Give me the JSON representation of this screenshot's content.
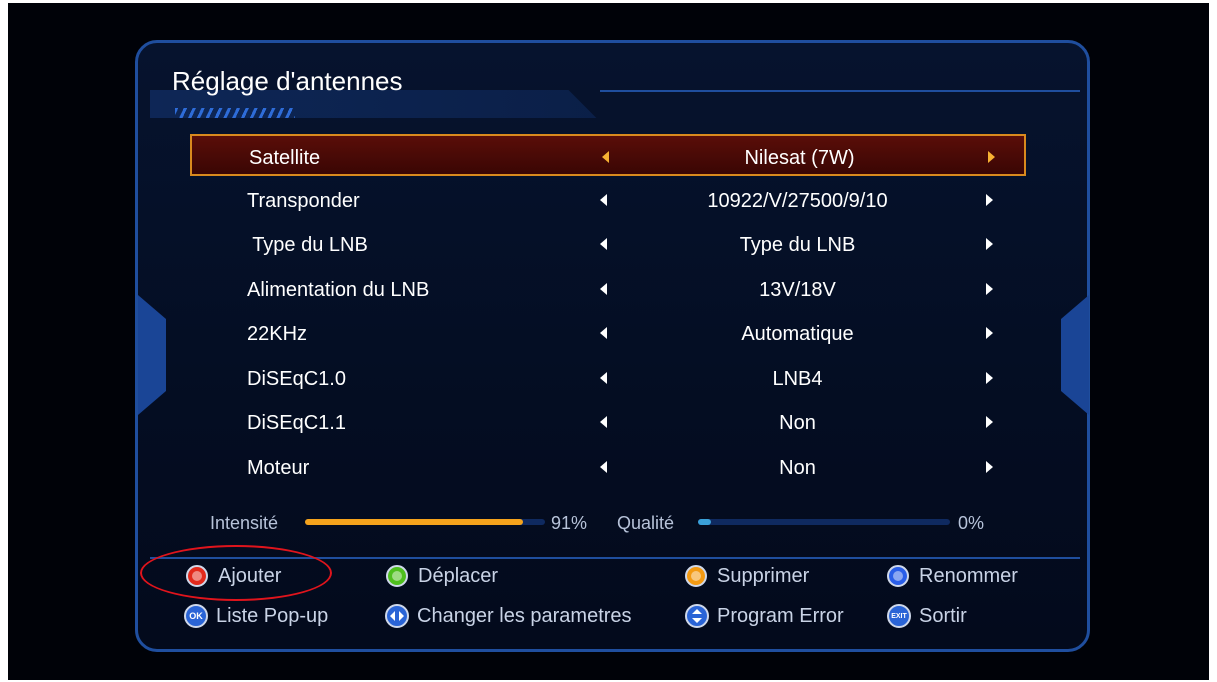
{
  "title": "Réglage d'antennes",
  "rows": [
    {
      "label": "Satellite",
      "value": "Nilesat (7W)"
    },
    {
      "label": "Transponder",
      "value": "10922/V/27500/9/10"
    },
    {
      "label": " Type du LNB",
      "value": "Type du LNB"
    },
    {
      "label": "Alimentation du LNB",
      "value": "13V/18V"
    },
    {
      "label": "22KHz",
      "value": "Automatique"
    },
    {
      "label": "DiSEqC1.0",
      "value": "LNB4"
    },
    {
      "label": "DiSEqC1.1",
      "value": "Non"
    },
    {
      "label": "Moteur",
      "value": "Non"
    }
  ],
  "selected_row": 0,
  "signal": {
    "intensity_label": "Intensité",
    "intensity_text": "91%",
    "intensity_level": 0.91,
    "quality_label": "Qualité",
    "quality_text": "0%",
    "quality_level": 0.0
  },
  "legend": {
    "red": "Ajouter",
    "green": "Déplacer",
    "orange": "Supprimer",
    "blue": "Renommer",
    "ok": "Liste Pop-up",
    "ok_icon": "OK",
    "left_right": "Changer les parametres",
    "up_down": "Program Error",
    "exit": "Sortir",
    "exit_icon": "EXIT"
  },
  "colors": {
    "intensity_bar": "#f5a31c",
    "quality_bar": "#3aa0d8",
    "selection_border": "#d98a1e",
    "annotation_circle": "#e0141c"
  }
}
